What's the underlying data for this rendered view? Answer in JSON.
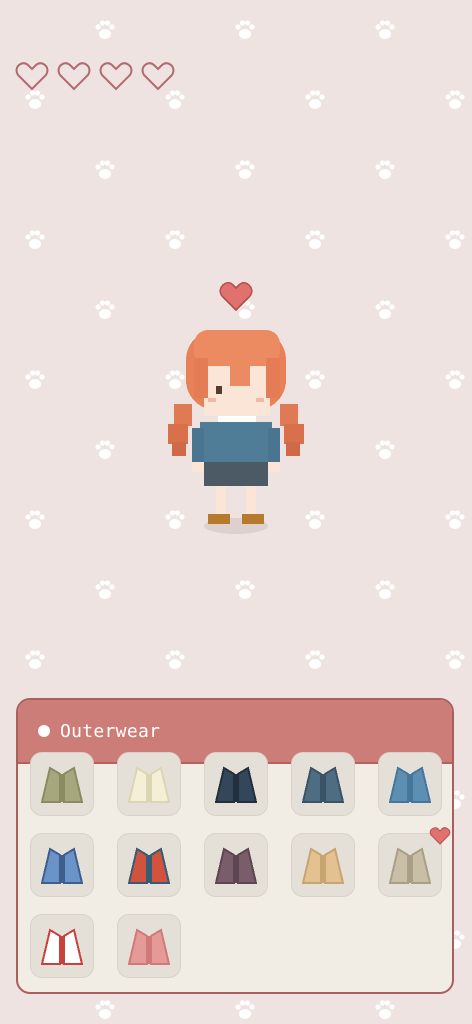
{
  "hearts": {
    "filled": 0,
    "total": 4
  },
  "category": {
    "label": "Outerwear"
  },
  "items": [
    {
      "name": "olive-jacket",
      "colors": [
        "#a6a77c",
        "#8a8b63"
      ]
    },
    {
      "name": "cream-coat",
      "colors": [
        "#f4efd6",
        "#dcd5b5"
      ]
    },
    {
      "name": "navy-jacket",
      "colors": [
        "#34465a",
        "#222f3e"
      ]
    },
    {
      "name": "slate-coat",
      "colors": [
        "#4e6c82",
        "#3a5367"
      ]
    },
    {
      "name": "blue-jacket",
      "colors": [
        "#5d8fb3",
        "#46769b"
      ]
    },
    {
      "name": "denim-jacket",
      "colors": [
        "#6a94c8",
        "#3e5f8e"
      ]
    },
    {
      "name": "plaid-coat",
      "colors": [
        "#d1533e",
        "#365b74"
      ]
    },
    {
      "name": "mauve-coat",
      "colors": [
        "#7a5d6a",
        "#5d4651"
      ]
    },
    {
      "name": "tan-coat",
      "colors": [
        "#e3c191",
        "#c8a471"
      ]
    },
    {
      "name": "khaki-coat",
      "colors": [
        "#c8bfa6",
        "#a89f86"
      ],
      "favorite": true
    },
    {
      "name": "sailor-coat",
      "colors": [
        "#ffffff",
        "#c9403d"
      ]
    },
    {
      "name": "pink-coat",
      "colors": [
        "#e59a98",
        "#cf7a78"
      ]
    }
  ]
}
